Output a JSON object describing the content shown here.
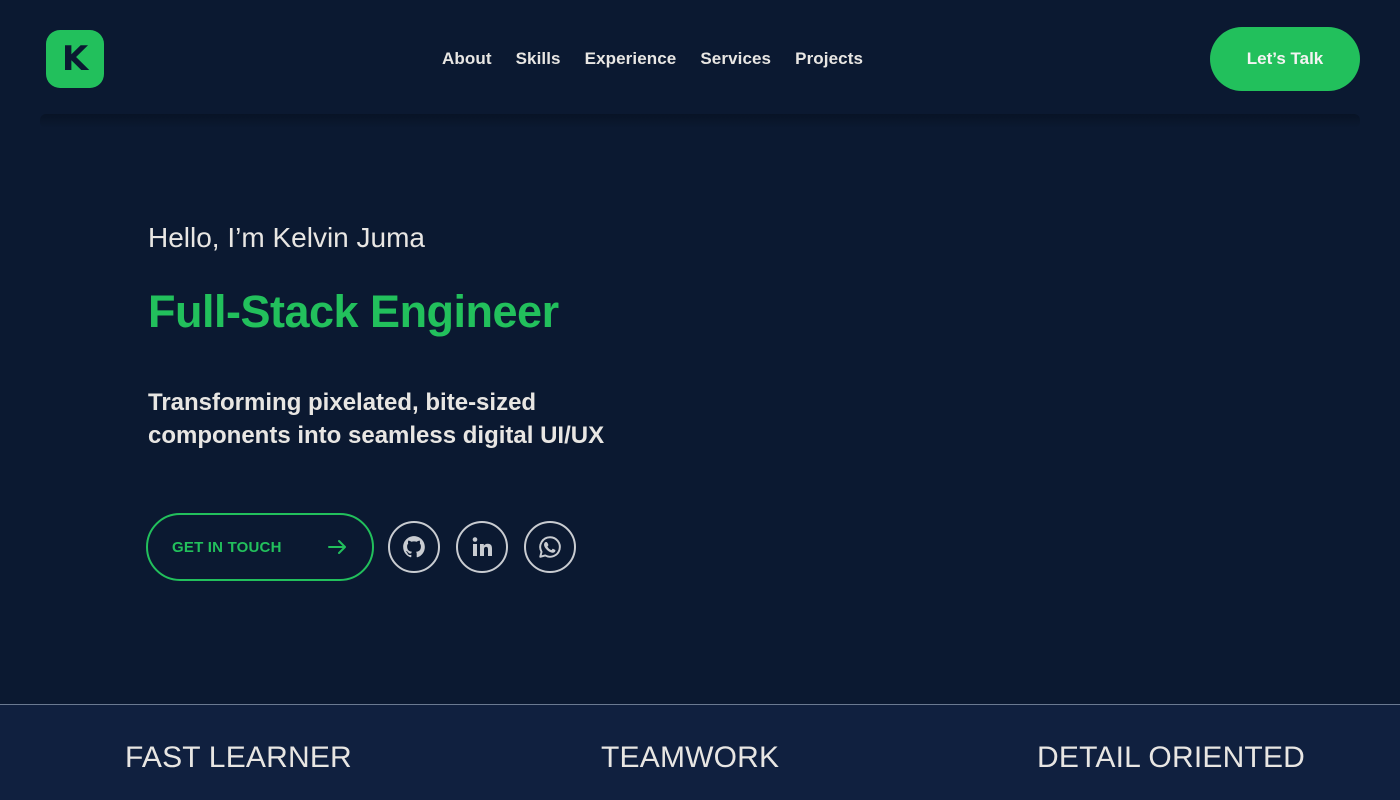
{
  "logo": {
    "letter": "K"
  },
  "nav": {
    "items": [
      {
        "label": "About"
      },
      {
        "label": "Skills"
      },
      {
        "label": "Experience"
      },
      {
        "label": "Services"
      },
      {
        "label": "Projects"
      }
    ],
    "cta_label": "Let’s Talk"
  },
  "hero": {
    "greeting": "Hello, I’m Kelvin Juma",
    "role": "Full-Stack Engineer",
    "tagline_line1": "Transforming pixelated, bite-sized",
    "tagline_line2": "components into seamless digital UI/UX",
    "get_in_touch": "GET IN TOUCH",
    "social": [
      {
        "icon": "github-icon"
      },
      {
        "icon": "linkedin-icon"
      },
      {
        "icon": "whatsapp-icon"
      }
    ]
  },
  "traits": [
    "FAST LEARNER",
    "TEAMWORK",
    "DETAIL ORIENTED"
  ],
  "colors": {
    "background": "#0b1931",
    "accent": "#22c05c",
    "strip": "#10203f",
    "text": "#e8e6e3"
  }
}
